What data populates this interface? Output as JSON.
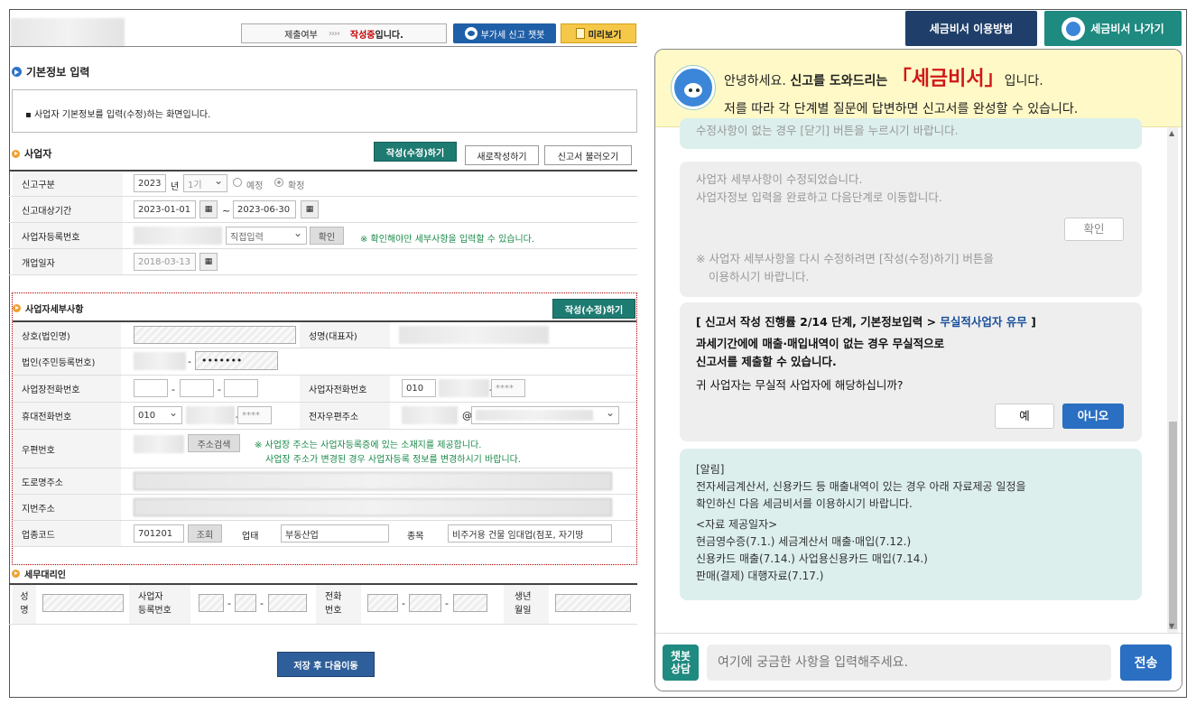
{
  "topbar": {
    "status_label": "제출여부",
    "status_arrows": "››››",
    "status_value": "작성중",
    "status_suffix": "입니다.",
    "vat_chatbot_btn": "부가세 신고 챗봇",
    "preview_btn": "미리보기"
  },
  "basic_info": {
    "title": "기본정보 입력",
    "desc": "▪ 사업자 기본정보를 입력(수정)하는 화면입니다."
  },
  "business": {
    "title": "사업자",
    "edit_btn": "작성(수정)하기",
    "new_btn": "새로작성하기",
    "load_btn": "신고서 불러오기",
    "report_type_label": "신고구분",
    "year": "2023",
    "year_unit": "년",
    "period": "1기",
    "radio_prelim": "예정",
    "radio_final": "확정",
    "period_label": "신고대상기간",
    "start_date": "2023-01-01",
    "tilde": "~",
    "end_date": "2023-06-30",
    "bizno_label": "사업자등록번호",
    "direct_input": "직접입력",
    "confirm_btn": "확인",
    "confirm_note": "※ 확인해야만 세부사항을 입력할 수 있습니다.",
    "open_label": "개업일자",
    "open_date": "2018-03-13"
  },
  "detail": {
    "title": "사업자세부사항",
    "edit_btn": "작성(수정)하기",
    "company_label": "상호(법인명)",
    "ceo_label": "성명(대표자)",
    "corp_label": "법인(주민등록번호)",
    "masked_id": "•••••••",
    "dash": "-",
    "shop_phone_label": "사업장전화번호",
    "biz_phone_label": "사업자전화번호",
    "biz_phone_prefix": "010",
    "masked4": "****",
    "mobile_label": "휴대전화번호",
    "mobile_prefix": "010",
    "email_label": "전자우편주소",
    "at": "@",
    "zip_label": "우편번호",
    "addr_search_btn": "주소검색",
    "addr_note1": "※ 사업장 주소는 사업자등록증에 있는 소재지를 제공합니다.",
    "addr_note2": "사업장 주소가 변경된 경우 사업자등록 정보를 변경하시기 바랍니다.",
    "road_label": "도로명주소",
    "lot_label": "지번주소",
    "industry_label": "업종코드",
    "industry_code": "701201",
    "lookup_btn": "조회",
    "type_label": "업태",
    "type_value": "부동산업",
    "item_label": "종목",
    "item_value": "비주거용 건물 임대업(점포, 자기땅"
  },
  "agent": {
    "title": "세무대리인",
    "name_label_1": "성",
    "name_label_2": "명",
    "bizno_label_1": "사업자",
    "bizno_label_2": "등록번호",
    "phone_label_1": "전화",
    "phone_label_2": "번호",
    "birth_label_1": "생년",
    "birth_label_2": "월일"
  },
  "save_btn": "저장 후 다음이동",
  "header_buttons": {
    "guide": "세금비서 이용방법",
    "exit": "세금비서 나가기"
  },
  "chat": {
    "greet_pre": "안녕하세요. ",
    "greet_bold": "신고를 도와드리는",
    "greet_name": "「세금비서」",
    "greet_post": "입니다.",
    "greet_line2": "저를 따라 각 단계별 질문에 답변하면 신고서를 완성할 수 있습니다.",
    "msg0": "수정사항이 없는 경우 [닫기] 버튼을 누르시기 바랍니다.",
    "msg1_l1": "사업자 세부사항이 수정되었습니다.",
    "msg1_l2": "사업자정보 입력을 완료하고 다음단계로 이동합니다.",
    "msg1_btn": "확인",
    "msg1_note1": "※ 사업자 세부사항을 다시 수정하려면 [작성(수정)하기] 버튼을",
    "msg1_note2": "이용하시기 바랍니다.",
    "msg2_head": "[ 신고서 작성 진행률 2/14 단계, 기본정보입력 > ",
    "msg2_link": "무실적사업자 유무",
    "msg2_tail": " ]",
    "msg2_l1": "과세기간에에 매출·매입내역이 없는 경우 무실적으로",
    "msg2_l2": "신고서를 제출할 수 있습니다.",
    "msg2_q": "귀 사업자는 무실적 사업자에 해당하십니까?",
    "yes_btn": "예",
    "no_btn": "아니오",
    "notice_title": "[알림]",
    "notice_l1": "전자세금계산서, 신용카드 등 매출내역이 있는 경우 아래 자료제공 일정을",
    "notice_l2": "확인하신 다음 세금비서를 이용하시기 바랍니다.",
    "notice_sub": "<자료 제공일자>",
    "notice_d1": "현금영수증(7.1.) 세금계산서 매출·매입(7.12.)",
    "notice_d2": "신용카드 매출(7.14.) 사업용신용카드 매입(7.14.)",
    "notice_d3": "판매(결제) 대행자료(7.17.)",
    "chatbot_label": "챗봇\n상담",
    "input_placeholder": "여기에 궁금한 사항을 입력해주세요.",
    "send_btn": "전송"
  },
  "colors": {
    "green_btn": "#1e7b72",
    "navy_btn": "#1f3f6a",
    "greet_bg": "#fff9c7",
    "bubble_teal": "#dcefed",
    "red_title": "#d01818"
  }
}
